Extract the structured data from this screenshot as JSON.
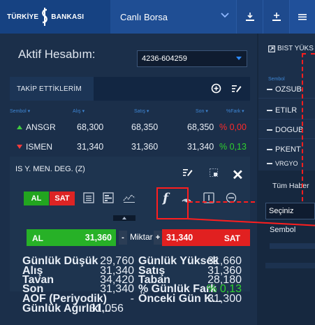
{
  "topbar": {
    "brand_left": "TÜRKİYE",
    "brand_right": "BANKASI",
    "mode": "Canlı Borsa"
  },
  "account": {
    "label": "Aktif Hesabım:",
    "selected": "4236-604259"
  },
  "watchlist": {
    "title": "TAKİP ETTİKLERİM",
    "columns": [
      "Sembol ▾",
      "Alış ▾",
      "Satış ▾",
      "Son ▾",
      "%Fark ▾"
    ],
    "rows": [
      {
        "symbol": "ANSGR",
        "direction": "up",
        "alis": "68,300",
        "satis": "68,350",
        "son": "68,350",
        "fark": "% 0,00",
        "fark_color": "#ff2a2a"
      },
      {
        "symbol": "ISMEN",
        "direction": "down",
        "alis": "31,340",
        "satis": "31,360",
        "son": "31,340",
        "fark": "% 0,13",
        "fark_color": "#2ed12e"
      }
    ]
  },
  "detail": {
    "name": "IS Y. MEN. DEG. (Z)",
    "buy_label": "AL",
    "sell_label": "SAT",
    "tools": [
      "list-icon",
      "depth-icon",
      "chart-icon",
      "function-icon",
      "signal-icon",
      "info-icon",
      "target-icon"
    ],
    "order": {
      "buy_label": "AL",
      "buy_price": "31,360",
      "minus": "-",
      "qty_label": "Miktar",
      "plus": "+",
      "sell_price": "31,340",
      "sell_label": "SAT"
    },
    "stats_left": [
      {
        "k": "Günlük Düşük",
        "v": "29,760"
      },
      {
        "k": "Alış",
        "v": "31,340"
      },
      {
        "k": "Tavan",
        "v": "34,420"
      },
      {
        "k": "Son",
        "v": "31,340"
      },
      {
        "k": "AOF (Periyodik)",
        "v": "-"
      },
      {
        "k": "Günlük Ağırlıkl...",
        "v": "31,056"
      }
    ],
    "stats_right": [
      {
        "k": "Günlük Yüksek",
        "v": "31,660"
      },
      {
        "k": "Satış",
        "v": "31,360"
      },
      {
        "k": "Taban",
        "v": "28,180"
      },
      {
        "k": "% Günlük Fark",
        "v": "% 0,13"
      },
      {
        "k": "Önceki Gün K...",
        "v": "31,300"
      }
    ]
  },
  "right_panel": {
    "bist_title": "BIST YÜKS",
    "sembol_col": "Sembol",
    "symbols": [
      "OZSUB",
      "ETILR",
      "DOGUB",
      "PKENT",
      "VRGYO"
    ],
    "news_tab": "Tüm Haber",
    "filter_value": "Seçiniz",
    "sembol_label": "Sembol"
  },
  "colors": {
    "accent": "#1e4a8d",
    "buy": "#22a51f",
    "sell": "#dd2424",
    "annotation": "#ff1e1e"
  }
}
